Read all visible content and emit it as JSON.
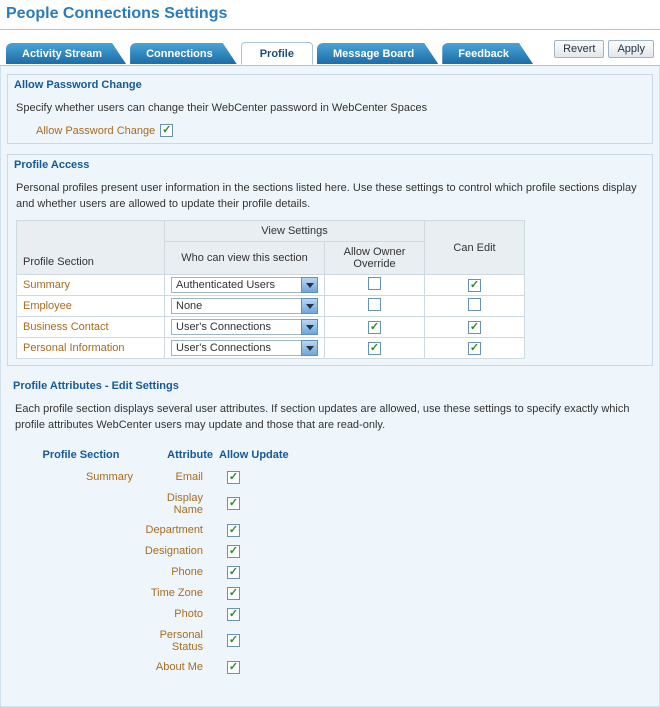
{
  "page_title": "People Connections Settings",
  "tabs": [
    "Activity Stream",
    "Connections",
    "Profile",
    "Message Board",
    "Feedback"
  ],
  "active_tab_index": 2,
  "actions": {
    "revert": "Revert",
    "apply": "Apply"
  },
  "allow_password": {
    "title": "Allow Password Change",
    "desc": "Specify whether users can change their WebCenter password in WebCenter Spaces",
    "label": "Allow Password Change",
    "checked": true
  },
  "profile_access": {
    "title": "Profile Access",
    "desc": "Personal profiles present user information in the sections listed here. Use these settings to control which profile sections display and whether users are allowed to update their profile details.",
    "headers": {
      "profile_section": "Profile Section",
      "view_settings": "View Settings",
      "who_view": "Who can view this section",
      "allow_override": "Allow Owner Override",
      "can_edit": "Can Edit"
    },
    "rows": [
      {
        "section": "Summary",
        "who": "Authenticated Users",
        "override": false,
        "can_edit": true
      },
      {
        "section": "Employee",
        "who": "None",
        "override": false,
        "can_edit": false
      },
      {
        "section": "Business Contact",
        "who": "User's Connections",
        "override": true,
        "can_edit": true
      },
      {
        "section": "Personal Information",
        "who": "User's Connections",
        "override": true,
        "can_edit": true
      }
    ]
  },
  "attributes": {
    "title": "Profile Attributes - Edit Settings",
    "desc": "Each profile section displays several user attributes. If section updates are allowed, use these settings to specify exactly which profile attributes WebCenter users may update and those that are read-only.",
    "headers": {
      "profile_section": "Profile Section",
      "attribute": "Attribute",
      "allow_update": "Allow Update"
    },
    "rows": [
      {
        "section": "Summary",
        "attr": "Email",
        "allow": true
      },
      {
        "section": "",
        "attr": "Display Name",
        "allow": true
      },
      {
        "section": "",
        "attr": "Department",
        "allow": true
      },
      {
        "section": "",
        "attr": "Designation",
        "allow": true
      },
      {
        "section": "",
        "attr": "Phone",
        "allow": true
      },
      {
        "section": "",
        "attr": "Time Zone",
        "allow": true
      },
      {
        "section": "",
        "attr": "Photo",
        "allow": true
      },
      {
        "section": "",
        "attr": "Personal Status",
        "allow": true
      },
      {
        "section": "",
        "attr": "About Me",
        "allow": true
      }
    ]
  }
}
